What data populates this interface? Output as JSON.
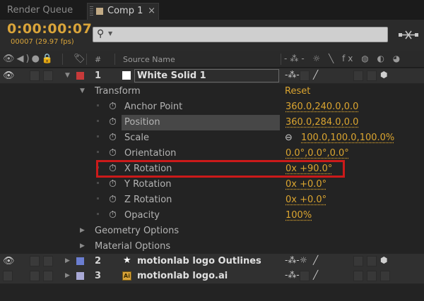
{
  "tabs": {
    "render_queue": "Render Queue",
    "comp": "Comp 1",
    "close": "×"
  },
  "toolbar": {
    "timecode": "0:00:00:07",
    "frames": "00007 (29.97 fps)",
    "search_value": ""
  },
  "header": {
    "hash": "#",
    "source_name": "Source Name",
    "switch_icons": "-⁂- ☼ ╲ fx ◍ ◐ ◕"
  },
  "layers": [
    {
      "num": "1",
      "name": "White Solid 1",
      "label_color": "#c73a3a",
      "icon": "white-solid"
    },
    {
      "num": "2",
      "name": "motionlab logo Outlines",
      "label_color": "#6b7ed1",
      "icon": "star"
    },
    {
      "num": "3",
      "name": "motionlab logo.ai",
      "label_color": "#a9a9d6",
      "icon": "ai-file"
    }
  ],
  "transform": {
    "label": "Transform",
    "reset": "Reset",
    "properties": [
      {
        "name": "Anchor Point",
        "value": "360.0,240.0,0.0"
      },
      {
        "name": "Position",
        "value": "360.0,284.0,0.0"
      },
      {
        "name": "Scale",
        "value": "100.0,100.0,100.0%"
      },
      {
        "name": "Orientation",
        "value": "0.0°,0.0°,0.0°"
      },
      {
        "name": "X Rotation",
        "value": "0x +90.0°"
      },
      {
        "name": "Y Rotation",
        "value": "0x +0.0°"
      },
      {
        "name": "Z Rotation",
        "value": "0x +0.0°"
      },
      {
        "name": "Opacity",
        "value": "100%"
      }
    ]
  },
  "groups": {
    "geometry": "Geometry Options",
    "material": "Material Options"
  },
  "colors": {
    "accent": "#dba530",
    "highlight_box": "#cc1a1a"
  }
}
